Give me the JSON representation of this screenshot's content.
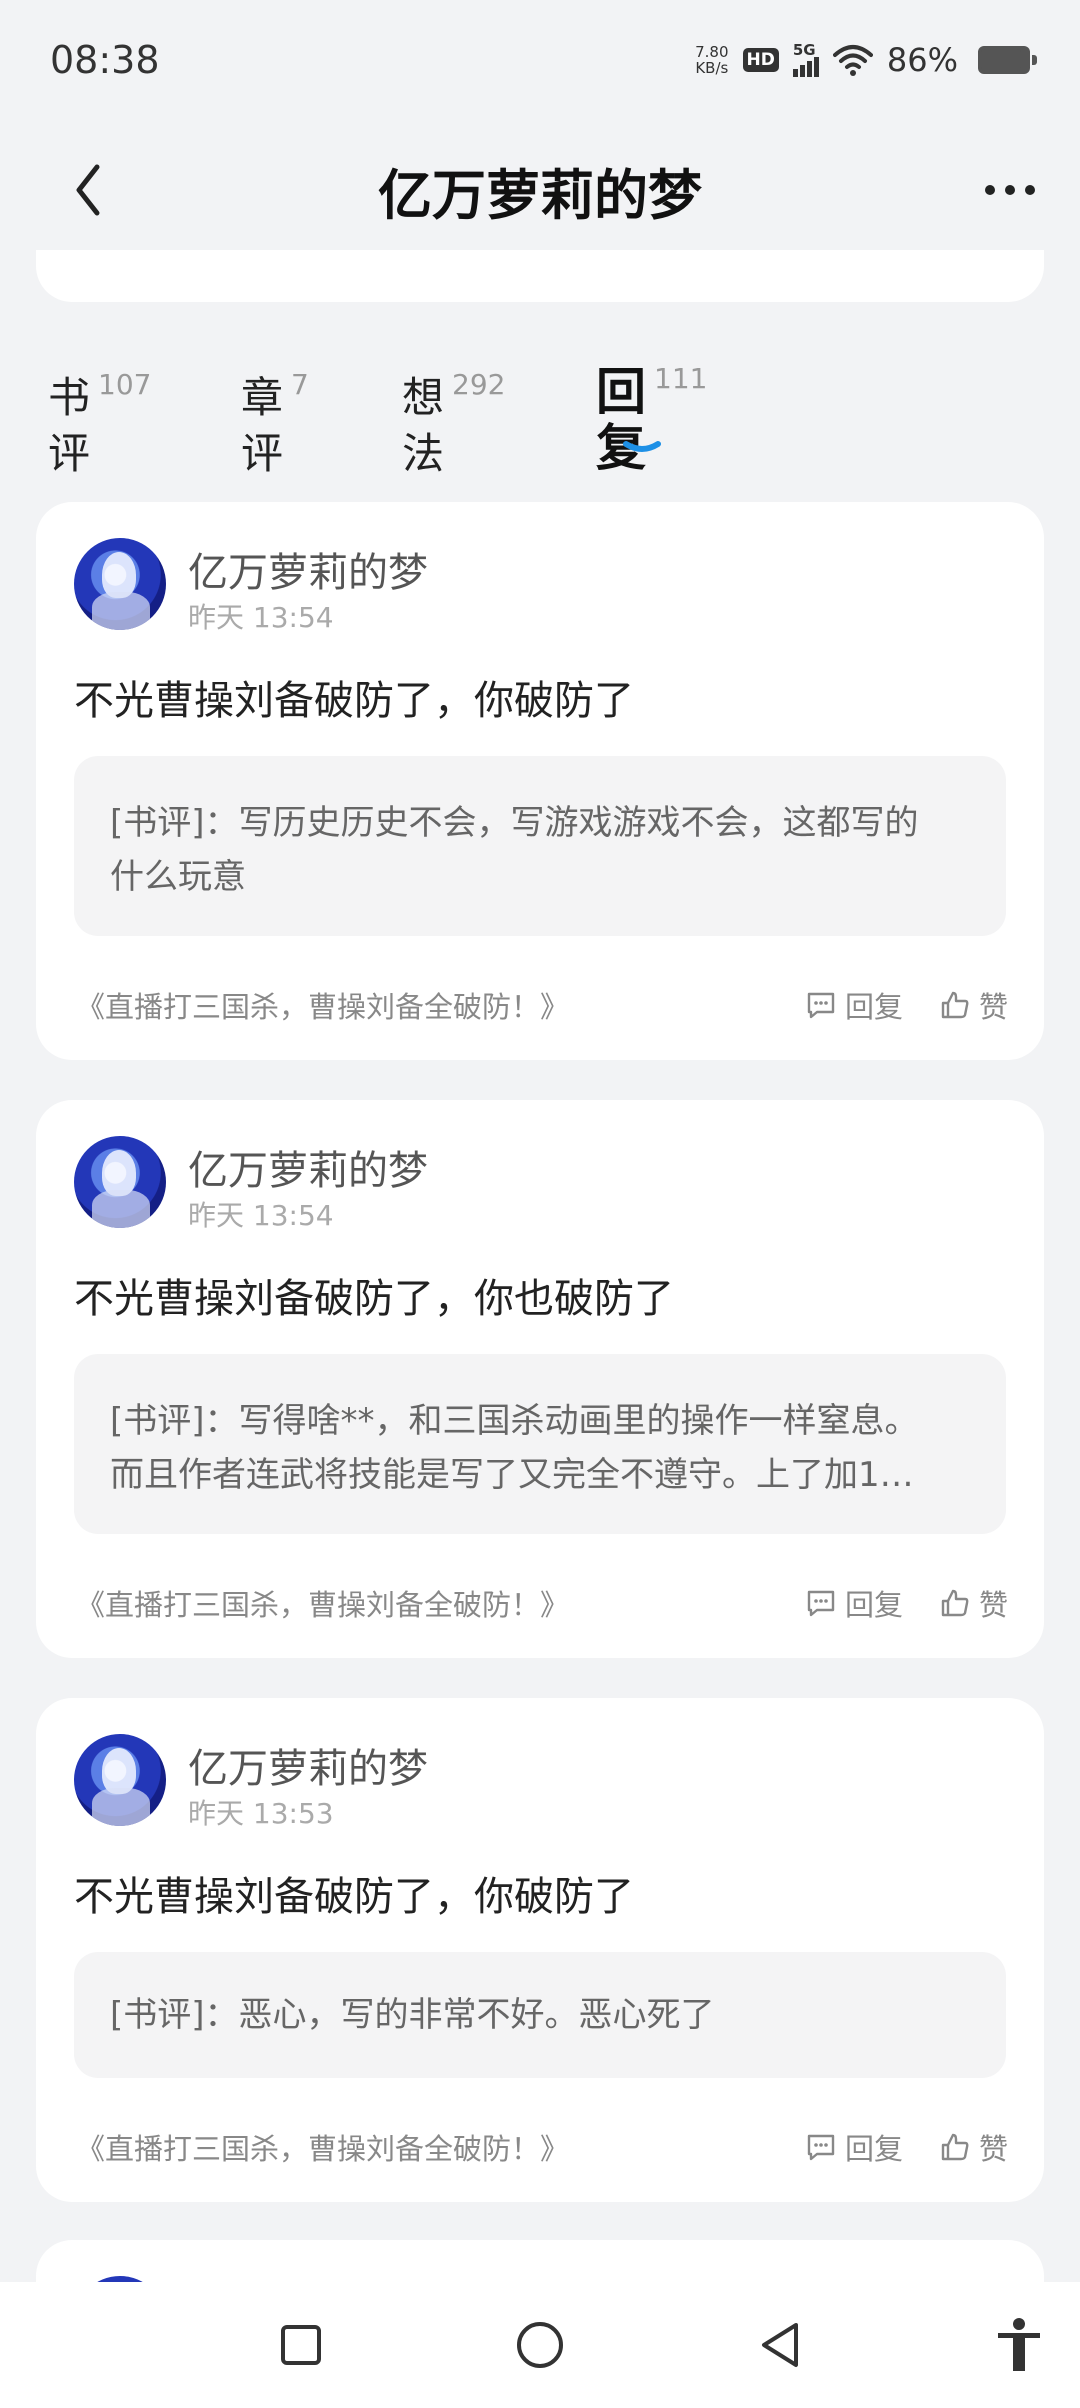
{
  "status_bar": {
    "time": "08:38",
    "net_speed_value": "7.80",
    "net_speed_unit": "KB/s",
    "hd_label": "HD",
    "network_label": "5G",
    "battery_percent": "86%",
    "battery_level": 0.86
  },
  "header": {
    "title": "亿万萝莉的梦",
    "back_icon": "chevron-left-icon",
    "more_icon": "more-horizontal-icon"
  },
  "tabs": [
    {
      "label": "书评",
      "count": "107"
    },
    {
      "label": "章评",
      "count": "7"
    },
    {
      "label": "想法",
      "count": "292"
    },
    {
      "label": "回复",
      "count": "111",
      "active": true
    }
  ],
  "accent_color": "#1e90e6",
  "cards": [
    {
      "user": "亿万萝莉的梦",
      "time": "昨天 13:54",
      "reply": "不光曹操刘备破防了，你破防了",
      "quote_line1": "[书评]：写历史历史不会，写游戏游戏不会，这都写的",
      "quote_line2": "什么玩意",
      "book": "《直播打三国杀，曹操刘备全破防！》",
      "reply_label": "回复",
      "like_label": "赞"
    },
    {
      "user": "亿万萝莉的梦",
      "time": "昨天 13:54",
      "reply": "不光曹操刘备破防了，你也破防了",
      "quote_line1": "[书评]：写得啥**，和三国杀动画里的操作一样窒息。",
      "quote_line2": "而且作者连武将技能是写了又完全不遵守。上了加1…",
      "book": "《直播打三国杀，曹操刘备全破防！》",
      "reply_label": "回复",
      "like_label": "赞"
    },
    {
      "user": "亿万萝莉的梦",
      "time": "昨天 13:53",
      "reply": "不光曹操刘备破防了，你破防了",
      "quote_line1": "[书评]：恶心，写的非常不好。恶心死了",
      "book": "《直播打三国杀，曹操刘备全破防！》",
      "reply_label": "回复",
      "like_label": "赞"
    }
  ],
  "nav_bar": {
    "recents_icon": "square-icon",
    "home_icon": "circle-icon",
    "back_icon": "triangle-back-icon",
    "accessibility_icon": "accessibility-icon"
  }
}
